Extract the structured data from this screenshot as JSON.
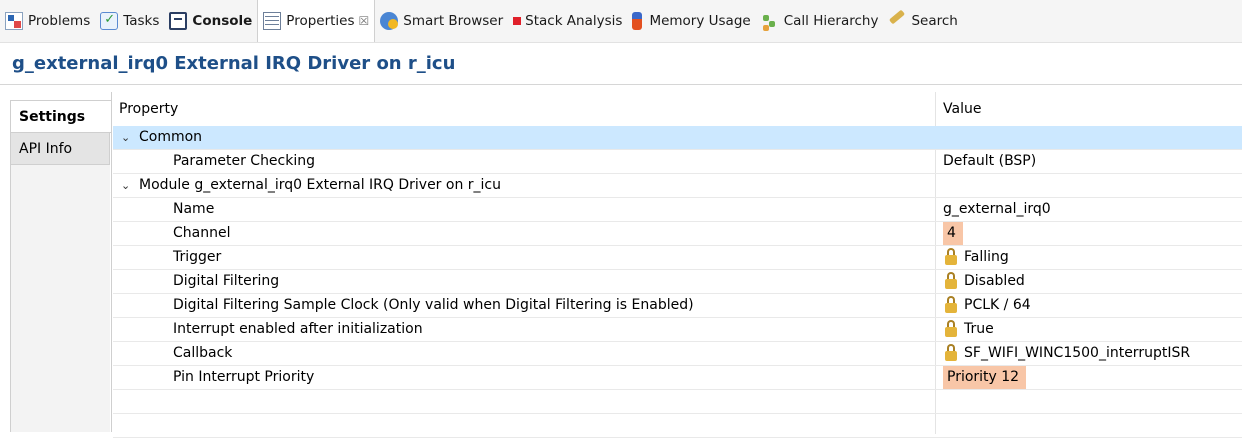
{
  "tabs": [
    {
      "label": "Problems",
      "icon": "problems-icon"
    },
    {
      "label": "Tasks",
      "icon": "tasks-icon"
    },
    {
      "label": "Console",
      "icon": "console-icon",
      "bold": true
    },
    {
      "label": "Properties",
      "icon": "properties-icon",
      "active": true,
      "close": "☒"
    },
    {
      "label": "Smart Browser",
      "icon": "smart-browser-icon"
    },
    {
      "label": "Stack Analysis",
      "icon": "stack-analysis-icon"
    },
    {
      "label": "Memory Usage",
      "icon": "memory-usage-icon"
    },
    {
      "label": "Call Hierarchy",
      "icon": "call-hierarchy-icon"
    },
    {
      "label": "Search",
      "icon": "search-icon"
    }
  ],
  "title": "g_external_irq0 External IRQ Driver on r_icu",
  "side_tabs": {
    "settings": "Settings",
    "api_info": "API Info"
  },
  "table": {
    "header_property": "Property",
    "header_value": "Value",
    "common_group": "Common",
    "parameter_checking": {
      "label": "Parameter Checking",
      "value": "Default (BSP)"
    },
    "module_group": "Module g_external_irq0 External IRQ Driver on r_icu",
    "name": {
      "label": "Name",
      "value": "g_external_irq0"
    },
    "channel": {
      "label": "Channel",
      "value": "4"
    },
    "trigger": {
      "label": "Trigger",
      "value": "Falling"
    },
    "digital_filtering": {
      "label": "Digital Filtering",
      "value": "Disabled"
    },
    "sample_clock": {
      "label": "Digital Filtering Sample Clock (Only valid when Digital Filtering is Enabled)",
      "value": "PCLK / 64"
    },
    "interrupt_enabled": {
      "label": "Interrupt enabled after initialization",
      "value": "True"
    },
    "callback": {
      "label": "Callback",
      "value": "SF_WIFI_WINC1500_interruptISR"
    },
    "pin_priority": {
      "label": "Pin Interrupt Priority",
      "value": "Priority 12"
    }
  },
  "colors": {
    "title": "#1e4f88",
    "selected_row": "#cce8ff",
    "highlight_value": "#f8c6a7",
    "lock": "#e4b43a"
  }
}
